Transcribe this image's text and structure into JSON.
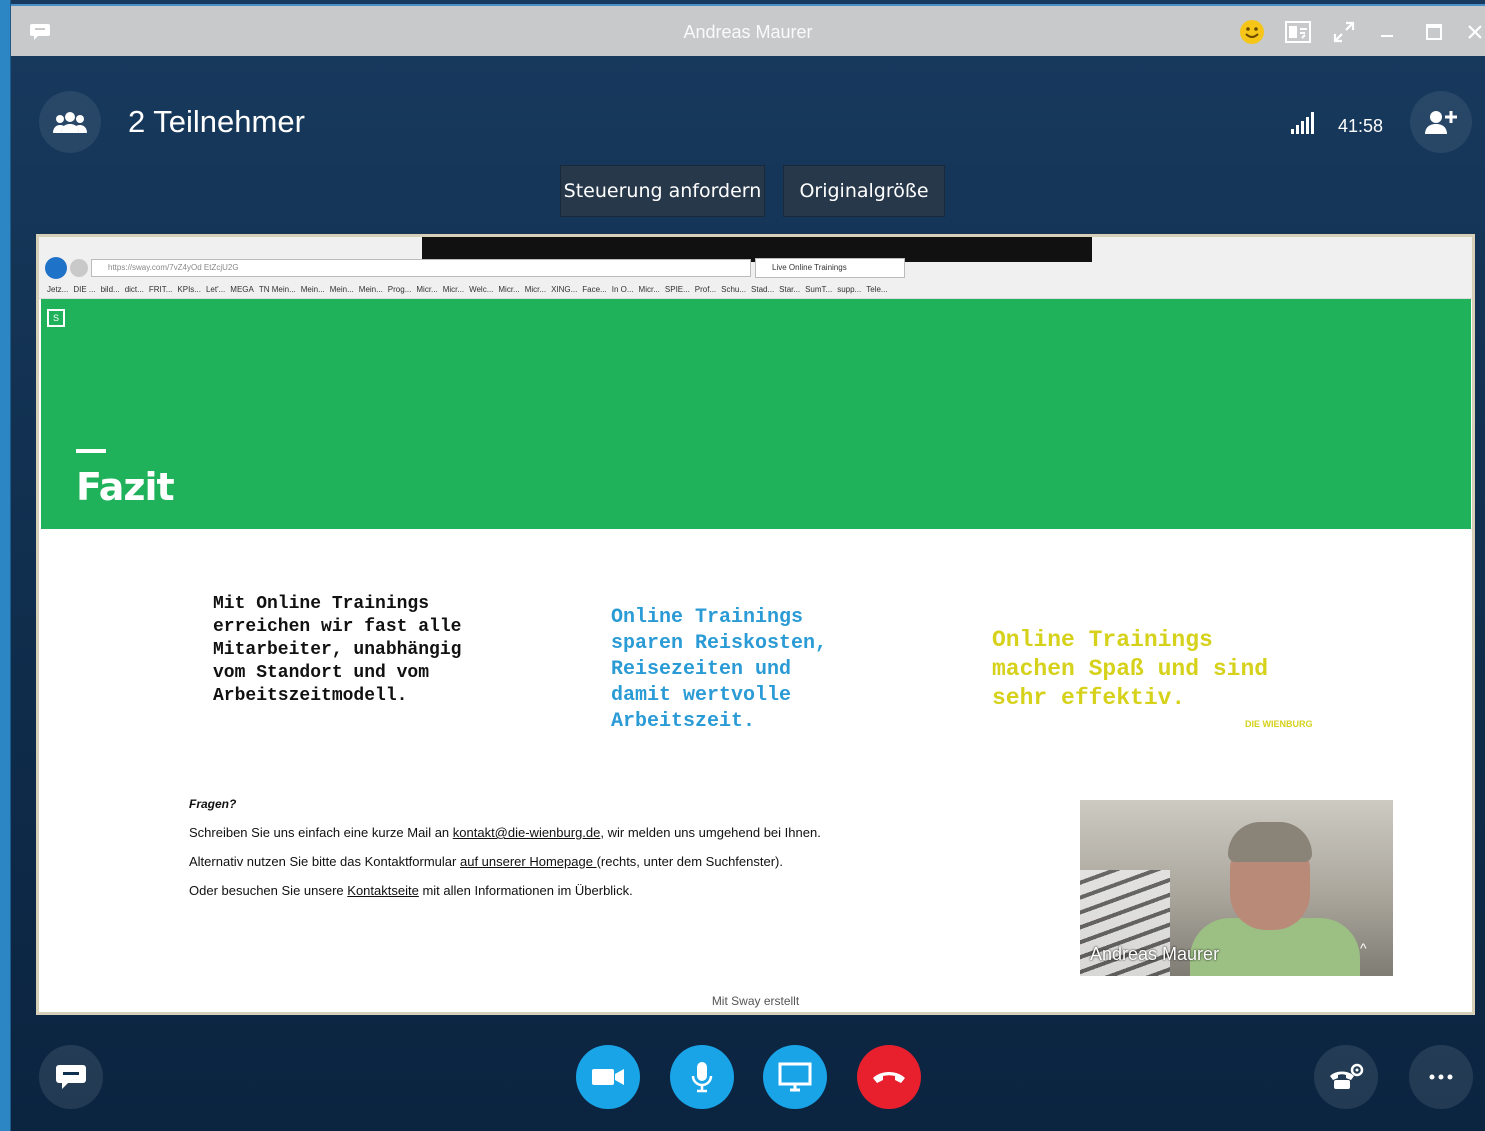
{
  "window": {
    "title": "Andreas Maurer"
  },
  "header": {
    "participants_label": "2 Teilnehmer",
    "call_timer": "41:58"
  },
  "controls": {
    "request_control": "Steuerung anfordern",
    "original_size": "Originalgröße"
  },
  "browser": {
    "url": "https://sway.com/7vZ4yOd EtZcjU2G",
    "tab_title": "Live Online Trainings",
    "favorites": [
      "Jetz...",
      "DIE ...",
      "bild...",
      "dict...",
      "FRIT...",
      "KPIs...",
      "Let'...",
      "MEGA",
      "TN Mein...",
      "Mein...",
      "Mein...",
      "Mein...",
      "Prog...",
      "Micr...",
      "Micr...",
      "Welc...",
      "Micr...",
      "Micr...",
      "XING...",
      "Face...",
      "In O...",
      "Micr...",
      "SPIE...",
      "Prof...",
      "Schu...",
      "Stad...",
      "Star...",
      "SumT...",
      "supp...",
      "Tele..."
    ]
  },
  "sway": {
    "hero_title": "Fazit",
    "col1": [
      "Mit Online Trainings",
      "erreichen wir fast alle",
      "Mitarbeiter, unabhängig",
      "vom Standort und vom",
      "Arbeitszeitmodell."
    ],
    "col2": [
      "Online Trainings",
      "sparen Reiskosten,",
      "Reisezeiten und",
      "damit wertvolle",
      "Arbeitszeit."
    ],
    "col3": [
      "Online Trainings",
      "machen Spaß und sind",
      "sehr effektiv."
    ],
    "brand_small": "DIE WIENBURG",
    "fragen": "Fragen?",
    "line1_pre": "Schreiben Sie uns einfach eine kurze Mail an ",
    "line1_link": "kontakt@die-wienburg.de",
    "line1_post": ", wir melden uns umgehend bei Ihnen.",
    "line2_pre": "Alternativ nutzen Sie bitte das Kontaktformular ",
    "line2_link": "auf unserer Homepage ",
    "line2_post": "(rechts, unter dem Suchfenster).",
    "line3_pre": "Oder besuchen Sie unsere ",
    "line3_link": "Kontaktseite",
    "line3_post": " mit allen Informationen im Überblick.",
    "footer": "Mit Sway erstellt"
  },
  "webcam": {
    "name": "Andreas Maurer"
  },
  "colors": {
    "video_btn": "#1aa4e8",
    "mic_btn": "#1aa4e8",
    "share_btn": "#1aa4e8",
    "hangup_btn": "#e8202e",
    "sway_green": "#1fb25a"
  }
}
